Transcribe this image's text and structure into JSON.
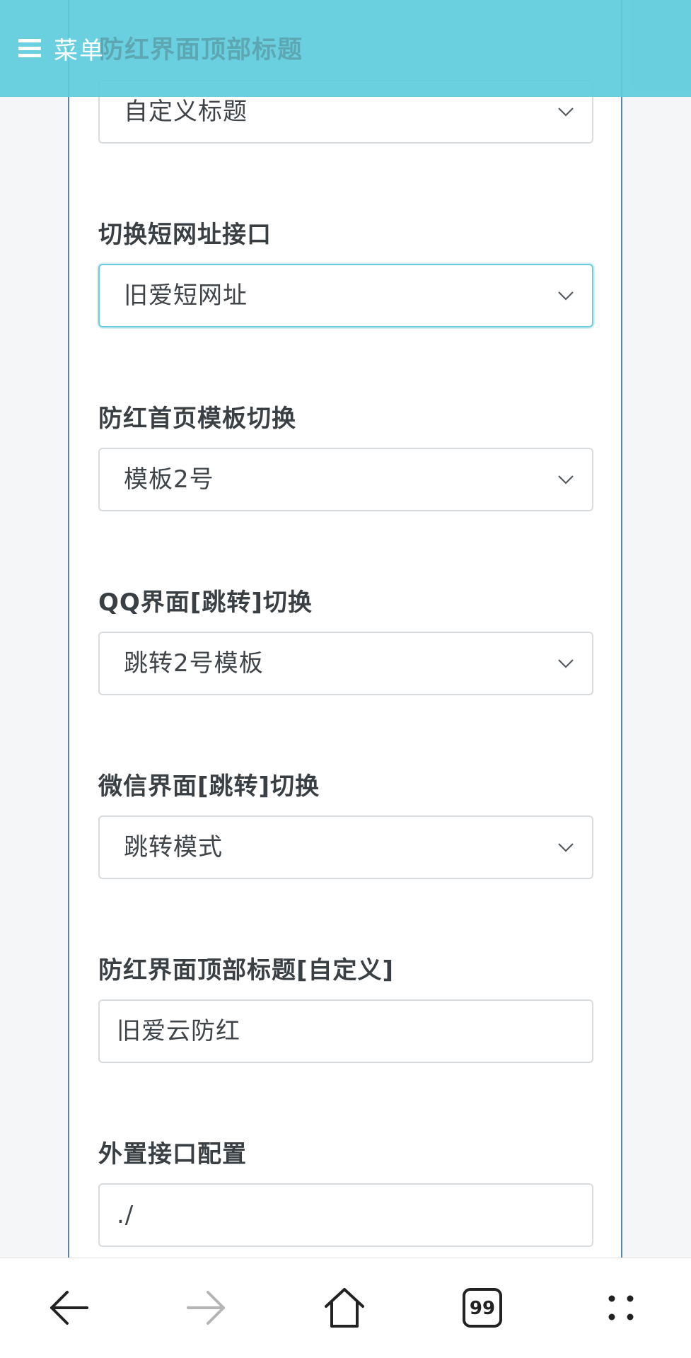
{
  "header": {
    "menu_label": "菜单",
    "ghost_title": "防红界面顶部标题"
  },
  "form": {
    "title_select": {
      "value": "自定义标题"
    },
    "shortlink": {
      "label": "切换短网址接口",
      "value": "旧爱短网址"
    },
    "home_template": {
      "label": "防红首页模板切换",
      "value": "模板2号"
    },
    "qq_jump": {
      "label": "QQ界面[跳转]切换",
      "value": "跳转2号模板"
    },
    "wechat_jump": {
      "label": "微信界面[跳转]切换",
      "value": "跳转模式"
    },
    "custom_title": {
      "label": "防红界面顶部标题[自定义]",
      "value": "旧爱云防红"
    },
    "external_api": {
      "label": "外置接口配置",
      "value": "./"
    }
  },
  "bottom_nav": {
    "back_icon": "arrow-left-icon",
    "forward_icon": "arrow-right-icon",
    "home_icon": "home-icon",
    "tabs_count": "99",
    "more_icon": "dots-grid-icon"
  },
  "colors": {
    "header_bg": "#5dccdd",
    "focus_border": "#6ccbdc",
    "card_border": "#5b85a8"
  }
}
